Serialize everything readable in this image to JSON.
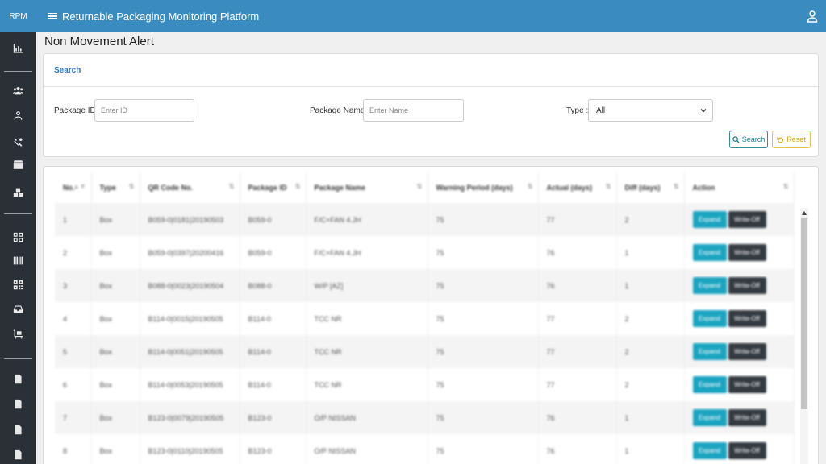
{
  "brand": "RPM",
  "app_title": "Returnable Packaging Monitoring Platform",
  "page_title": "Non Movement Alert",
  "search": {
    "header": "Search",
    "package_id_label": "Package ID :",
    "package_id_placeholder": "Enter ID",
    "package_id_value": "",
    "package_name_label": "Package Name :",
    "package_name_placeholder": "Enter Name",
    "package_name_value": "",
    "type_label": "Type :",
    "type_selected": "All",
    "search_button": "Search",
    "reset_button": "Reset"
  },
  "sidebar_icons": [
    "chart-icon",
    "users-icon",
    "user-icon",
    "tools-icon",
    "box-icon",
    "boxes-icon",
    "grid-icon",
    "barcode-icon",
    "qr-code-icon",
    "inbox-icon",
    "dolly-icon",
    "document-icon",
    "document-icon",
    "document-icon",
    "document-icon"
  ],
  "table": {
    "columns": [
      "No.",
      "Type",
      "QR Code No.",
      "Package ID",
      "Package Name",
      "Warning Period (days)",
      "Actual (days)",
      "Diff (days)",
      "Action"
    ],
    "expand_label": "Expand",
    "writeoff_label": "Write-Off",
    "rows": [
      [
        "1",
        "Box",
        "B059-0|0181|20190503",
        "B059-0",
        "F/C+FAN 4.JH",
        "75",
        "77",
        "2"
      ],
      [
        "2",
        "Box",
        "B059-0|0397|20200416",
        "B059-0",
        "F/C+FAN 4.JH",
        "75",
        "76",
        "1"
      ],
      [
        "3",
        "Box",
        "B088-0|0023|20190504",
        "B088-0",
        "W/P [AZ]",
        "75",
        "76",
        "1"
      ],
      [
        "4",
        "Box",
        "B114-0|0015|20190505",
        "B114-0",
        "TCC NR",
        "75",
        "77",
        "2"
      ],
      [
        "5",
        "Box",
        "B114-0|0051|20190505",
        "B114-0",
        "TCC NR",
        "75",
        "77",
        "2"
      ],
      [
        "6",
        "Box",
        "B114-0|0053|20190505",
        "B114-0",
        "TCC NR",
        "75",
        "77",
        "2"
      ],
      [
        "7",
        "Box",
        "B123-0|0079|20190505",
        "B123-0",
        "O/P NISSAN",
        "75",
        "76",
        "1"
      ],
      [
        "8",
        "Box",
        "B123-0|0110|20190505",
        "B123-0",
        "O/P NISSAN",
        "75",
        "76",
        "1"
      ]
    ]
  },
  "colors": {
    "topbar": "#3a8bc0",
    "sidebar": "#2b3036",
    "expand": "#1ba4c0",
    "writeoff": "#333a40",
    "search_accent": "#2b8ca0",
    "reset_accent": "#f0c040"
  }
}
